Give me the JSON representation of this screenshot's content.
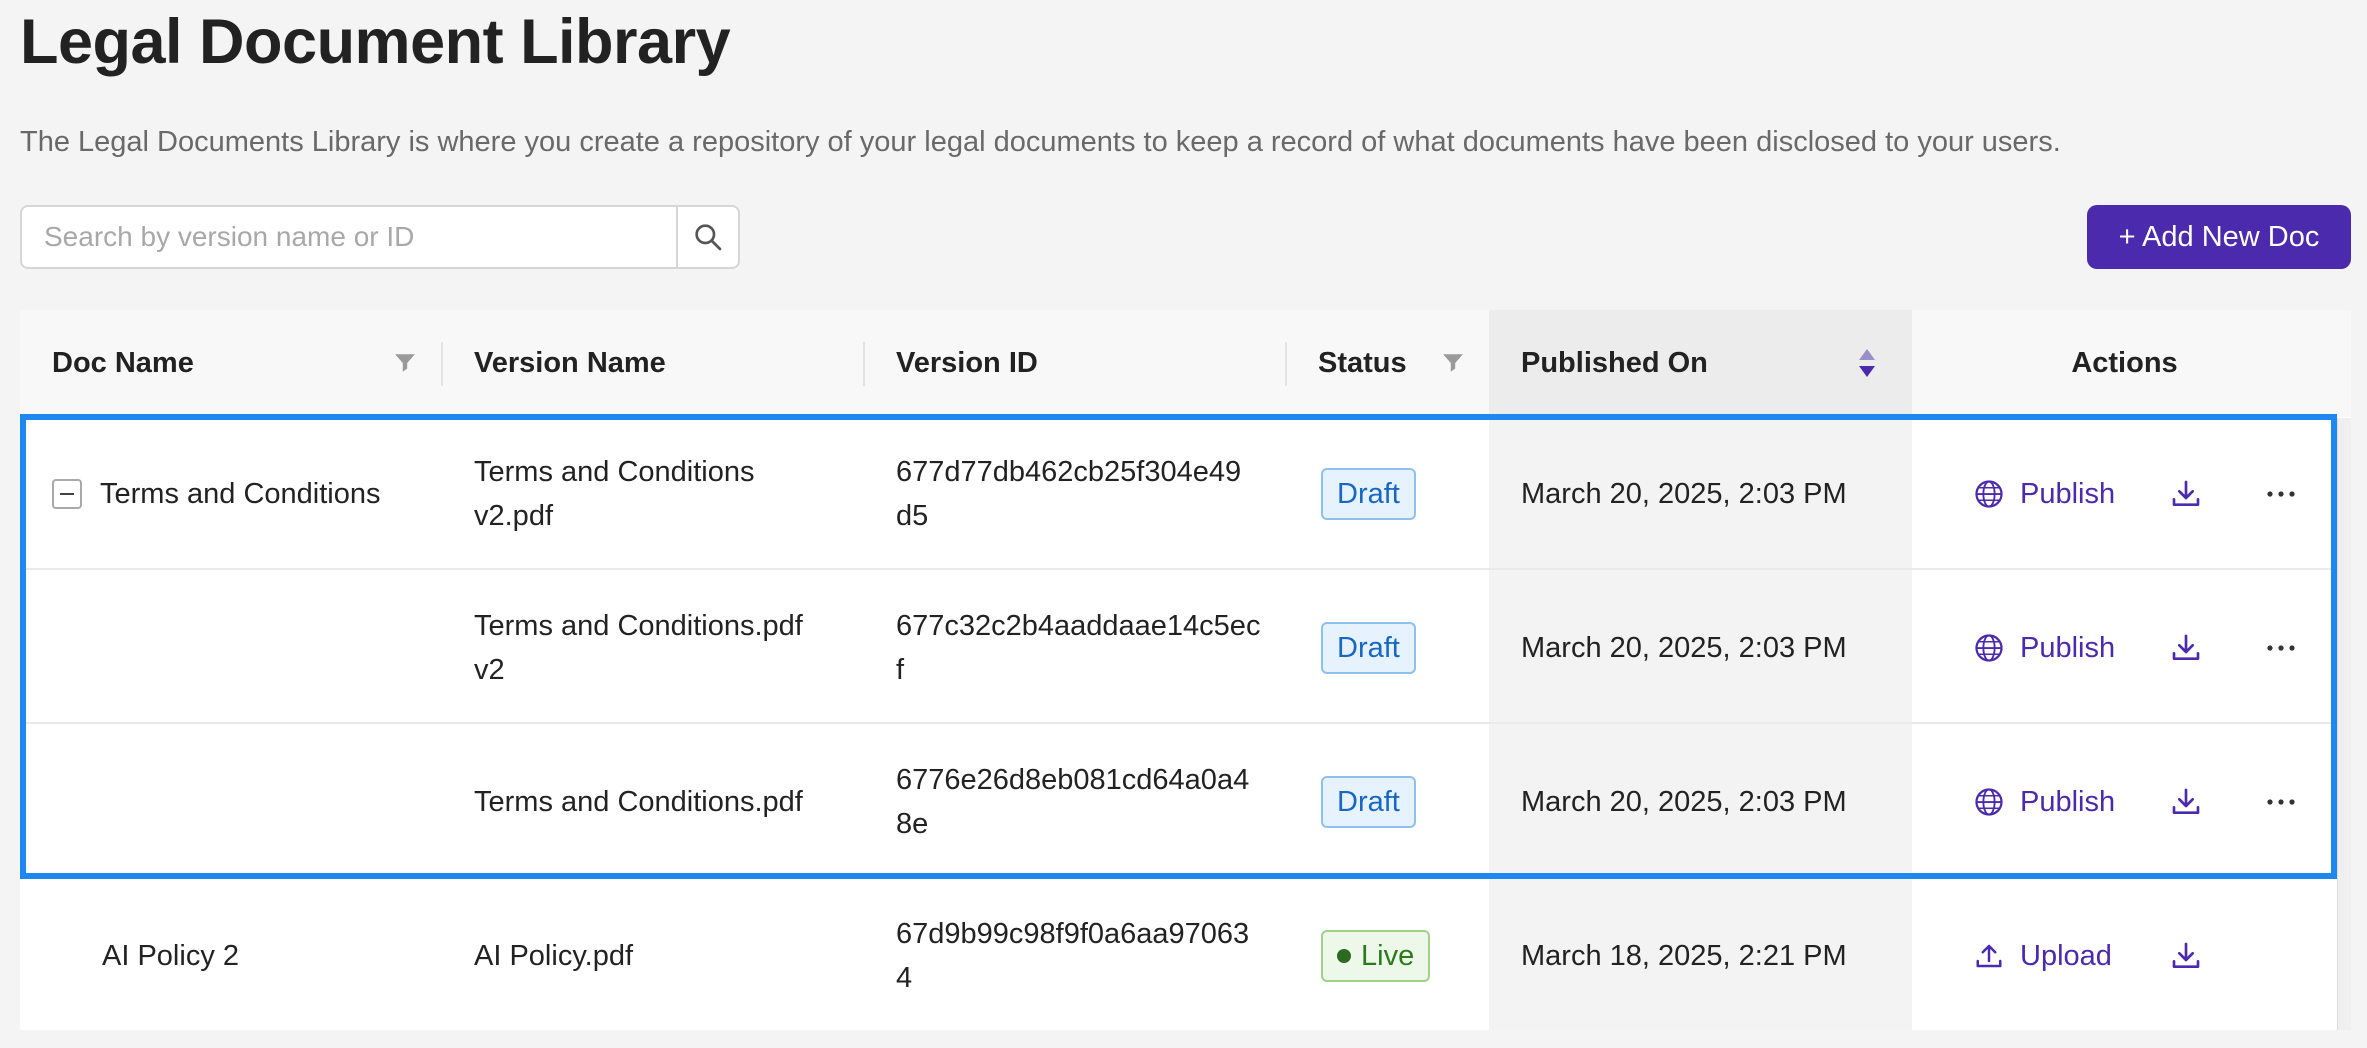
{
  "page": {
    "title": "Legal Document Library",
    "description": "The Legal Documents Library is where you create a repository of your legal documents to keep a record of what documents have been disclosed to your users."
  },
  "search": {
    "placeholder": "Search by version name or ID",
    "value": ""
  },
  "add_button": {
    "label": "+ Add New Doc"
  },
  "columns": {
    "doc_name": "Doc Name",
    "version_name": "Version Name",
    "version_id": "Version ID",
    "status": "Status",
    "published_on": "Published On",
    "actions": "Actions"
  },
  "rows": [
    {
      "doc_name": "Terms and Conditions",
      "version_name": [
        "Terms and Conditions",
        "v2.pdf"
      ],
      "version_id": [
        "677d77db462cb25f304e49",
        "d5"
      ],
      "status": "Draft",
      "published_on": "March 20, 2025, 2:03 PM",
      "primary_action": "Publish"
    },
    {
      "doc_name": "",
      "version_name": [
        "Terms and Conditions.pdf",
        "v2"
      ],
      "version_id": [
        "677c32c2b4aaddaae14c5ec",
        "f"
      ],
      "status": "Draft",
      "published_on": "March 20, 2025, 2:03 PM",
      "primary_action": "Publish"
    },
    {
      "doc_name": "",
      "version_name": [
        "Terms and Conditions.pdf"
      ],
      "version_id": [
        "6776e26d8eb081cd64a0a4",
        "8e"
      ],
      "status": "Draft",
      "published_on": "March 20, 2025, 2:03 PM",
      "primary_action": "Publish"
    },
    {
      "doc_name": "AI Policy 2",
      "version_name": [
        "AI Policy.pdf"
      ],
      "version_id": [
        "67d9b99c98f9f0a6aa97063",
        "4"
      ],
      "status": "Live",
      "published_on": "March 18, 2025, 2:21 PM",
      "primary_action": "Upload"
    }
  ],
  "colors": {
    "accent": "#4b2aad",
    "highlight": "#1e88f2",
    "draft": "#1767c4",
    "live": "#2c7a1b"
  },
  "icons": {
    "search": "search-icon",
    "filter": "filter-icon",
    "sort": "sort-icon",
    "publish": "globe-icon",
    "upload": "upload-icon",
    "download": "download-icon",
    "more": "more-icon",
    "collapse": "collapse-icon"
  }
}
